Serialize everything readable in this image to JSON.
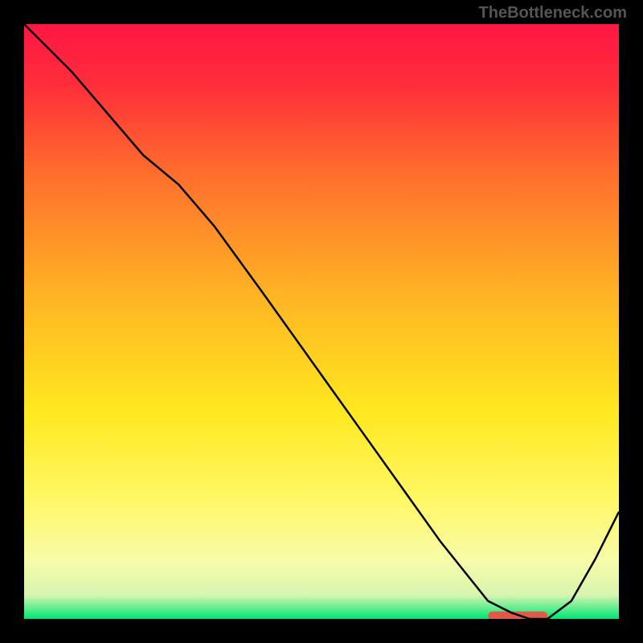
{
  "watermark": "TheBottleneck.com",
  "chart_data": {
    "type": "line",
    "title": "",
    "xlabel": "",
    "ylabel": "",
    "xlim": [
      0,
      100
    ],
    "ylim": [
      0,
      100
    ],
    "grid": false,
    "legend": false,
    "gradient_stops": [
      {
        "offset": 0,
        "color": "#ff1744"
      },
      {
        "offset": 10,
        "color": "#ff2d3a"
      },
      {
        "offset": 25,
        "color": "#ff6d2d"
      },
      {
        "offset": 45,
        "color": "#ffb224"
      },
      {
        "offset": 65,
        "color": "#ffe81f"
      },
      {
        "offset": 80,
        "color": "#fff866"
      },
      {
        "offset": 90,
        "color": "#f7fca8"
      },
      {
        "offset": 96,
        "color": "#d8f5b0"
      },
      {
        "offset": 100,
        "color": "#00e676"
      }
    ],
    "series": [
      {
        "name": "curve",
        "color": "#000000",
        "x": [
          0,
          8,
          14,
          20,
          26,
          32,
          40,
          50,
          60,
          70,
          78,
          82,
          85,
          88,
          92,
          96,
          100
        ],
        "values": [
          100,
          92,
          85,
          78,
          73,
          66,
          55,
          41,
          27,
          13,
          3,
          1,
          0,
          0,
          3,
          10,
          18
        ]
      }
    ],
    "marker": {
      "color": "#e05a4a",
      "x_start": 78,
      "x_end": 88,
      "y": 0.5,
      "height": 1.5
    }
  }
}
